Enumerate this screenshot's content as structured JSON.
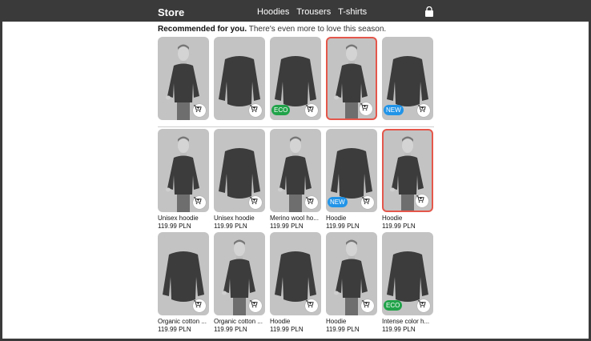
{
  "header": {
    "brand": "Store",
    "nav": [
      "Hoodies",
      "Trousers",
      "T-shirts"
    ]
  },
  "recommended": {
    "title_bold": "Recommended for you.",
    "title_rest": "There's even more to love this season.",
    "items": [
      {
        "figure": "person",
        "badge": "",
        "selected": false
      },
      {
        "figure": "shirt",
        "badge": "",
        "selected": false
      },
      {
        "figure": "shirt",
        "badge": "ECO",
        "selected": false
      },
      {
        "figure": "person",
        "badge": "",
        "selected": true
      },
      {
        "figure": "shirt",
        "badge": "NEW",
        "selected": false
      }
    ]
  },
  "products": [
    {
      "figure": "person",
      "badge": "",
      "selected": false,
      "name": "Unisex hoodie",
      "price": "119.99 PLN"
    },
    {
      "figure": "shirt",
      "badge": "",
      "selected": false,
      "name": "Unisex hoodie",
      "price": "119.99 PLN"
    },
    {
      "figure": "person",
      "badge": "",
      "selected": false,
      "name": "Merino wool ho...",
      "price": "119.99 PLN"
    },
    {
      "figure": "shirt",
      "badge": "NEW",
      "selected": false,
      "name": "Hoodie",
      "price": "119.99 PLN"
    },
    {
      "figure": "person",
      "badge": "",
      "selected": true,
      "name": "Hoodie",
      "price": "119.99 PLN"
    },
    {
      "figure": "shirt",
      "badge": "",
      "selected": false,
      "name": "Organic cotton ...",
      "price": "119.99 PLN"
    },
    {
      "figure": "person",
      "badge": "",
      "selected": false,
      "name": "Organic cotton ...",
      "price": "119.99 PLN"
    },
    {
      "figure": "shirt",
      "badge": "",
      "selected": false,
      "name": "Hoodie",
      "price": "119.99 PLN"
    },
    {
      "figure": "person",
      "badge": "",
      "selected": false,
      "name": "Hoodie",
      "price": "119.99 PLN"
    },
    {
      "figure": "shirt",
      "badge": "ECO",
      "selected": false,
      "name": "Intense color h...",
      "price": "119.99 PLN"
    }
  ],
  "icons": {
    "bag": "shopping-bag-icon",
    "cart": "add-to-cart-icon"
  },
  "colors": {
    "header": "#3a3a3a",
    "eco": "#21a34a",
    "new": "#2194e8",
    "selected": "#e4574b"
  }
}
